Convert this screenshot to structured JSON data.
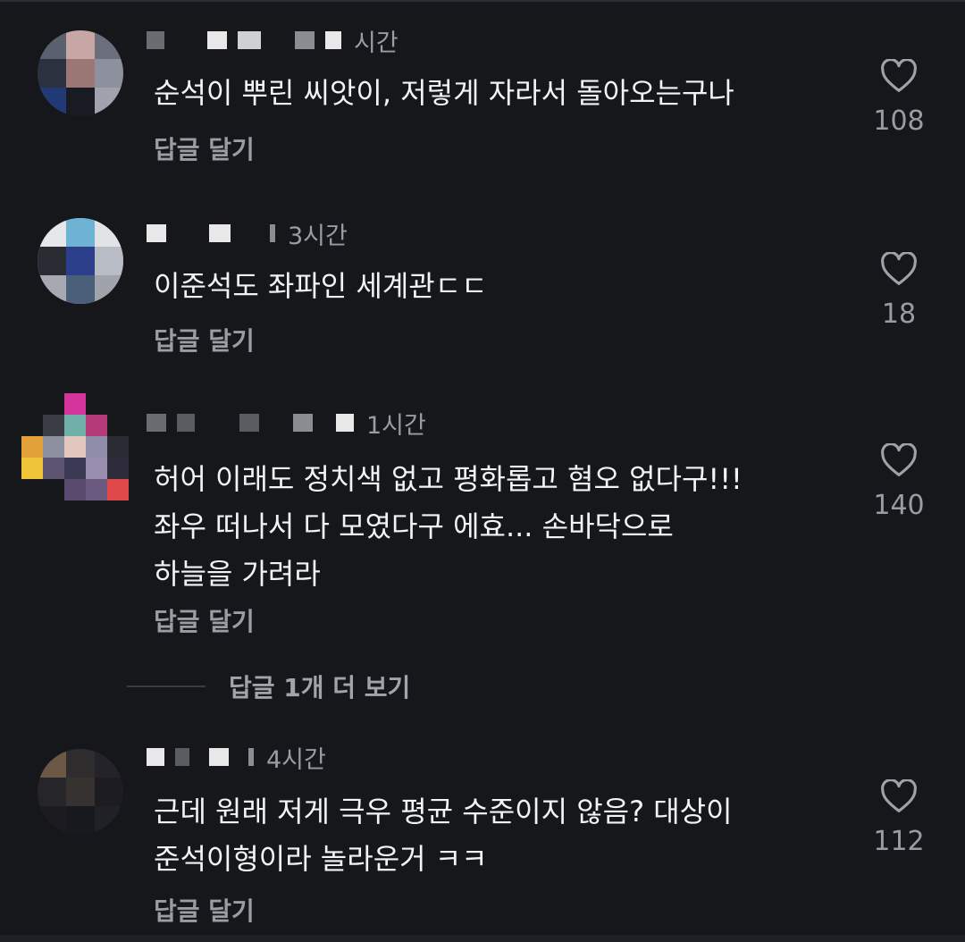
{
  "comments": [
    {
      "time": "시간",
      "text": "순석이 뿌린 씨앗이, 저렇게 자라서 돌아오는구나",
      "reply_label": "답글 달기",
      "likes": "108"
    },
    {
      "time": "3시간",
      "text": "이준석도 좌파인 세계관ㄷㄷ",
      "reply_label": "답글 달기",
      "likes": "18"
    },
    {
      "time": "1시간",
      "text": "허어 이래도 정치색 없고 평화롭고 혐오 없다구!!!\n좌우 떠나서 다 모였다구 에효... 손바닥으로\n하늘을 가려라",
      "reply_label": "답글 달기",
      "likes": "140",
      "more_replies_label": "답글 1개 더 보기"
    },
    {
      "time": "4시간",
      "text": "근데 원래 저게 극우 평균 수준이지 않음? 대상이\n준석이형이라 놀라운거 ㅋㅋ",
      "reply_label": "답글 달기",
      "likes": "112"
    }
  ],
  "icons": {
    "like": "heart-outline-icon"
  },
  "colors": {
    "background": "#15171b",
    "text": "#f2f3f5",
    "muted": "#9a9ca3"
  }
}
